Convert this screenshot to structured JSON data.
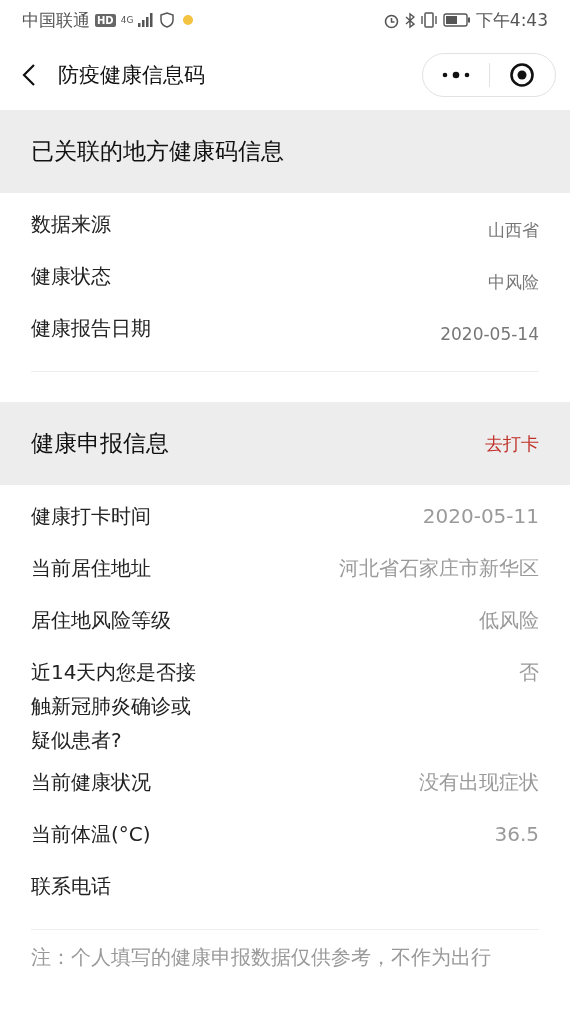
{
  "status_bar": {
    "carrier": "中国联通",
    "network_badge": "HD",
    "network": "4G",
    "time": "下午4:43"
  },
  "nav_bar": {
    "title": "防疫健康信息码"
  },
  "sections": [
    {
      "kind": "linked",
      "title": "已关联的地方健康码信息",
      "rows": [
        {
          "label": "数据来源",
          "value": "山西省"
        },
        {
          "label": "健康状态",
          "value": "中风险"
        },
        {
          "label": "健康报告日期",
          "value": "2020-05-14"
        }
      ]
    },
    {
      "kind": "report",
      "title": "健康申报信息",
      "action": "去打卡",
      "rows": [
        {
          "label": "健康打卡时间",
          "value": "2020-05-11"
        },
        {
          "label": "当前居住地址",
          "value": "河北省石家庄市新华区"
        },
        {
          "label": "居住地风险等级",
          "value": "低风险"
        },
        {
          "label": "近14天内您是否接触新冠肺炎确诊或疑似患者?",
          "value": "否"
        },
        {
          "label": "当前健康状况",
          "value": "没有出现症状"
        },
        {
          "label": "当前体温(°C)",
          "value": "36.5"
        },
        {
          "label": "联系电话"
        }
      ]
    }
  ],
  "note": "注：个人填写的健康申报数据仅供参考，不作为出行"
}
